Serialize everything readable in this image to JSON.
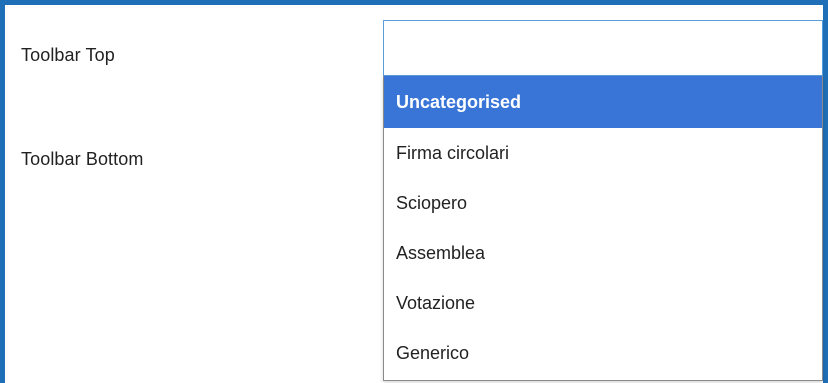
{
  "form": {
    "toolbar_top_label": "Toolbar Top",
    "toolbar_bottom_label": "Toolbar Bottom",
    "search_value": ""
  },
  "dropdown": {
    "options": [
      {
        "label": "Uncategorised",
        "selected": true
      },
      {
        "label": "Firma circolari",
        "selected": false
      },
      {
        "label": "Sciopero",
        "selected": false
      },
      {
        "label": "Assemblea",
        "selected": false
      },
      {
        "label": "Votazione",
        "selected": false
      },
      {
        "label": "Generico",
        "selected": false
      }
    ]
  },
  "colors": {
    "frame_border": "#1f6fb8",
    "highlight": "#3875d7",
    "input_border": "#5b9dd9"
  }
}
